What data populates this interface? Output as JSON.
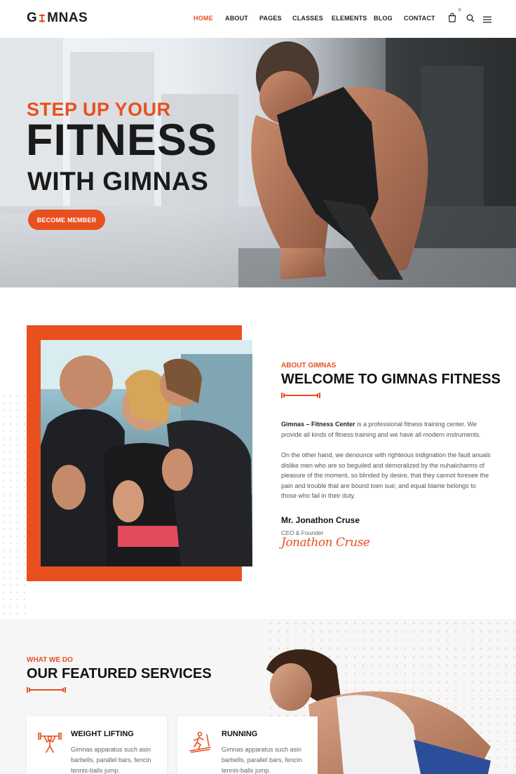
{
  "header": {
    "logo_left": "G",
    "logo_right": "MNAS",
    "nav": [
      {
        "label": "HOME",
        "active": true
      },
      {
        "label": "ABOUT",
        "active": false
      },
      {
        "label": "PAGES",
        "active": false
      },
      {
        "label": "CLASSES",
        "active": false
      },
      {
        "label": "ELEMENTS",
        "active": false
      },
      {
        "label": "BLOG",
        "active": false
      },
      {
        "label": "CONTACT",
        "active": false
      }
    ],
    "cart_count": "0",
    "icons": [
      "shopping-bag-icon",
      "search-icon",
      "menu-icon"
    ]
  },
  "hero": {
    "line1": "STEP UP YOUR",
    "line2": "FITNESS",
    "line3": "WITH GIMNAS",
    "button": "BECOME MEMBER"
  },
  "about": {
    "subtitle": "ABOUT GIMNAS",
    "title": "WELCOME TO GIMNAS FITNESS",
    "p1_bold": "Gimnas – Fitness Center",
    "p1_rest": " is a professional fitness training center. We provide all kinds of fitness training and we have all modern instruments.",
    "p2": "On the other hand, we denounce with righteous indignation the fault anuals dislike men who are so beguiled and demoralized by the nuhaiicharms of pleasure of the moment, so blinded by desire, that they cannot foresee the pain and trouble that are bound toen sue; and equal blame belongs to those who fail in their duty.",
    "name": "Mr. Jonathon Cruse",
    "role": "CEO & Founder",
    "signature": "Jonathon Cruse"
  },
  "services": {
    "subtitle": "WHAT WE DO",
    "title": "OUR FEATURED SERVICES",
    "cards": [
      {
        "title": "WEIGHT LIFTING",
        "desc": "Gimnas apparatus such asin barbells, parallel bars, fencin tennis-balls jump.",
        "icon": "weightlifter-icon"
      },
      {
        "title": "RUNNING",
        "desc": "Gimnas apparatus such asin barbells, parallel bars, fencin tennis-balls jump.",
        "icon": "treadmill-runner-icon"
      }
    ]
  },
  "colors": {
    "accent": "#e8501f",
    "dark": "#1a1a1a"
  }
}
